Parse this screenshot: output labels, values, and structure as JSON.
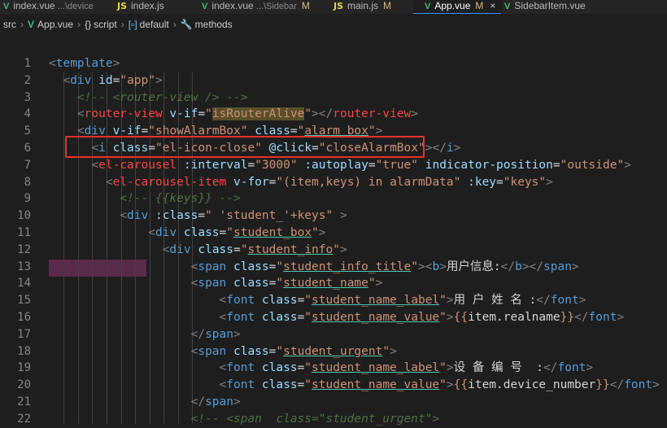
{
  "tabs": [
    {
      "icon": "vue",
      "label": "index.vue",
      "sub": "...\\device",
      "mod": ""
    },
    {
      "icon": "js",
      "label": "index.js",
      "sub": "",
      "mod": ""
    },
    {
      "icon": "vue",
      "label": "index.vue",
      "sub": "...\\Sidebar",
      "mod": "M"
    },
    {
      "icon": "js",
      "label": "main.js",
      "sub": "",
      "mod": "M"
    },
    {
      "icon": "vue",
      "label": "App.vue",
      "sub": "",
      "mod": "M",
      "active": true,
      "close": "×"
    },
    {
      "icon": "vue",
      "label": "SidebarItem.vue",
      "sub": "",
      "mod": ""
    }
  ],
  "breadcrumb": {
    "folder": "src",
    "file": "App.vue",
    "script": "script",
    "default": "default",
    "methods": "methods",
    "script_sym": "{}",
    "default_sym": "[▫]",
    "methods_sym": "🔧"
  },
  "line_numbers": [
    "1",
    "2",
    "3",
    "4",
    "5",
    "6",
    "7",
    "8",
    "9",
    "10",
    "11",
    "12",
    "13",
    "14",
    "15",
    "16",
    "17",
    "18",
    "19",
    "20",
    "21",
    "22"
  ],
  "code_lines": [
    [
      {
        "t": "<",
        "c": "pun"
      },
      {
        "t": "template",
        "c": "tag"
      },
      {
        "t": ">",
        "c": "pun"
      }
    ],
    [
      {
        "t": "  "
      },
      {
        "t": "<",
        "c": "pun"
      },
      {
        "t": "div",
        "c": "tag"
      },
      {
        "t": " id",
        "c": "at"
      },
      {
        "t": "=",
        "c": "txt"
      },
      {
        "t": "\"app\"",
        "c": "str"
      },
      {
        "t": ">",
        "c": "pun"
      }
    ],
    [
      {
        "t": "    "
      },
      {
        "t": "<!-- <router-view /> -->",
        "c": "com"
      }
    ],
    [
      {
        "t": "    "
      },
      {
        "t": "<",
        "c": "pun"
      },
      {
        "t": "router-view",
        "c": "red"
      },
      {
        "t": " v-if",
        "c": "at"
      },
      {
        "t": "=",
        "c": "txt"
      },
      {
        "t": "\"",
        "c": "str"
      },
      {
        "t": "isRouterAlive",
        "c": "str",
        "hl": true
      },
      {
        "t": "\"",
        "c": "str"
      },
      {
        "t": "></",
        "c": "pun"
      },
      {
        "t": "router-view",
        "c": "red"
      },
      {
        "t": ">",
        "c": "pun"
      }
    ],
    [
      {
        "t": "    "
      },
      {
        "t": "<",
        "c": "pun"
      },
      {
        "t": "div",
        "c": "tag"
      },
      {
        "t": " v-if",
        "c": "at"
      },
      {
        "t": "=",
        "c": "txt"
      },
      {
        "t": "\"showAlarmBox\"",
        "c": "str"
      },
      {
        "t": " class",
        "c": "at"
      },
      {
        "t": "=",
        "c": "txt"
      },
      {
        "t": "\"",
        "c": "str"
      },
      {
        "t": "alarm_box",
        "c": "str",
        "u": true
      },
      {
        "t": "\"",
        "c": "str"
      },
      {
        "t": ">",
        "c": "pun"
      }
    ],
    [
      {
        "t": "      "
      },
      {
        "t": "<",
        "c": "pun"
      },
      {
        "t": "i",
        "c": "tag"
      },
      {
        "t": " class",
        "c": "at"
      },
      {
        "t": "=",
        "c": "txt"
      },
      {
        "t": "\"el-icon-close\"",
        "c": "str"
      },
      {
        "t": " @click",
        "c": "at"
      },
      {
        "t": "=",
        "c": "txt"
      },
      {
        "t": "\"closeAlarmBox\"",
        "c": "str"
      },
      {
        "t": "></",
        "c": "pun"
      },
      {
        "t": "i",
        "c": "tag"
      },
      {
        "t": ">",
        "c": "pun"
      }
    ],
    [
      {
        "t": "      "
      },
      {
        "t": "<",
        "c": "pun"
      },
      {
        "t": "el-carousel",
        "c": "red"
      },
      {
        "t": " :interval",
        "c": "at"
      },
      {
        "t": "=",
        "c": "txt"
      },
      {
        "t": "\"3000\"",
        "c": "str"
      },
      {
        "t": " :autoplay",
        "c": "at"
      },
      {
        "t": "=",
        "c": "txt"
      },
      {
        "t": "\"true\"",
        "c": "str"
      },
      {
        "t": " indicator-position",
        "c": "at"
      },
      {
        "t": "=",
        "c": "txt"
      },
      {
        "t": "\"outside\"",
        "c": "str"
      },
      {
        "t": ">",
        "c": "pun"
      }
    ],
    [
      {
        "t": "        "
      },
      {
        "t": "<",
        "c": "pun"
      },
      {
        "t": "el-carousel-item",
        "c": "red"
      },
      {
        "t": " v-for",
        "c": "at"
      },
      {
        "t": "=",
        "c": "txt"
      },
      {
        "t": "\"(item,keys) in alarmData\"",
        "c": "str"
      },
      {
        "t": " :key",
        "c": "at"
      },
      {
        "t": "=",
        "c": "txt"
      },
      {
        "t": "\"keys\"",
        "c": "str"
      },
      {
        "t": ">",
        "c": "pun"
      }
    ],
    [
      {
        "t": "          "
      },
      {
        "t": "<!-- {{keys}} -->",
        "c": "com"
      }
    ],
    [
      {
        "t": "          "
      },
      {
        "t": "<",
        "c": "pun"
      },
      {
        "t": "div",
        "c": "tag"
      },
      {
        "t": " :class",
        "c": "at"
      },
      {
        "t": "=",
        "c": "txt"
      },
      {
        "t": "\" 'student_'+keys\"",
        "c": "str"
      },
      {
        "t": " >",
        "c": "pun"
      }
    ],
    [
      {
        "t": "              "
      },
      {
        "t": "<",
        "c": "pun"
      },
      {
        "t": "div",
        "c": "tag"
      },
      {
        "t": " class",
        "c": "at"
      },
      {
        "t": "=",
        "c": "txt"
      },
      {
        "t": "\"",
        "c": "str"
      },
      {
        "t": "student_box",
        "c": "str",
        "u": true
      },
      {
        "t": "\"",
        "c": "str"
      },
      {
        "t": ">",
        "c": "pun"
      }
    ],
    [
      {
        "t": "                "
      },
      {
        "t": "<",
        "c": "pun"
      },
      {
        "t": "div",
        "c": "tag"
      },
      {
        "t": " class",
        "c": "at"
      },
      {
        "t": "=",
        "c": "txt"
      },
      {
        "t": "\"",
        "c": "str"
      },
      {
        "t": "student_info",
        "c": "str",
        "u": true
      },
      {
        "t": "\"",
        "c": "str"
      },
      {
        "t": ">",
        "c": "pun"
      }
    ],
    [
      {
        "t": "                    "
      },
      {
        "t": "<",
        "c": "pun"
      },
      {
        "t": "span",
        "c": "tag"
      },
      {
        "t": " class",
        "c": "at"
      },
      {
        "t": "=",
        "c": "txt"
      },
      {
        "t": "\"",
        "c": "str"
      },
      {
        "t": "student_info_title",
        "c": "str",
        "u": true
      },
      {
        "t": "\"",
        "c": "str"
      },
      {
        "t": "><",
        "c": "pun"
      },
      {
        "t": "b",
        "c": "tag"
      },
      {
        "t": ">",
        "c": "pun"
      },
      {
        "t": "用户信息:",
        "c": "txt"
      },
      {
        "t": "</",
        "c": "pun"
      },
      {
        "t": "b",
        "c": "tag"
      },
      {
        "t": "></",
        "c": "pun"
      },
      {
        "t": "span",
        "c": "tag"
      },
      {
        "t": ">",
        "c": "pun"
      }
    ],
    [
      {
        "t": "                    "
      },
      {
        "t": "<",
        "c": "pun"
      },
      {
        "t": "span",
        "c": "tag"
      },
      {
        "t": " class",
        "c": "at"
      },
      {
        "t": "=",
        "c": "txt"
      },
      {
        "t": "\"",
        "c": "str"
      },
      {
        "t": "student_name",
        "c": "str",
        "u": true
      },
      {
        "t": "\"",
        "c": "str"
      },
      {
        "t": ">",
        "c": "pun"
      }
    ],
    [
      {
        "t": "                        "
      },
      {
        "t": "<",
        "c": "pun"
      },
      {
        "t": "font",
        "c": "tag"
      },
      {
        "t": " class",
        "c": "at"
      },
      {
        "t": "=",
        "c": "txt"
      },
      {
        "t": "\"",
        "c": "str"
      },
      {
        "t": "student_name_label",
        "c": "str",
        "u": true
      },
      {
        "t": "\"",
        "c": "str"
      },
      {
        "t": ">",
        "c": "pun"
      },
      {
        "t": "用 户 姓 名 :",
        "c": "txt"
      },
      {
        "t": "</",
        "c": "pun"
      },
      {
        "t": "font",
        "c": "tag"
      },
      {
        "t": ">",
        "c": "pun"
      }
    ],
    [
      {
        "t": "                        "
      },
      {
        "t": "<",
        "c": "pun"
      },
      {
        "t": "font",
        "c": "tag"
      },
      {
        "t": " class",
        "c": "at"
      },
      {
        "t": "=",
        "c": "txt"
      },
      {
        "t": "\"",
        "c": "str"
      },
      {
        "t": "student_name_value",
        "c": "str",
        "u": true
      },
      {
        "t": "\"",
        "c": "str"
      },
      {
        "t": ">",
        "c": "pun"
      },
      {
        "t": "{{",
        "c": "str"
      },
      {
        "t": "item.realname",
        "c": "txt"
      },
      {
        "t": "}}",
        "c": "str"
      },
      {
        "t": "</",
        "c": "pun"
      },
      {
        "t": "font",
        "c": "tag"
      },
      {
        "t": ">",
        "c": "pun"
      }
    ],
    [
      {
        "t": "                    "
      },
      {
        "t": "</",
        "c": "pun"
      },
      {
        "t": "span",
        "c": "tag"
      },
      {
        "t": ">",
        "c": "pun"
      }
    ],
    [
      {
        "t": "                    "
      },
      {
        "t": "<",
        "c": "pun"
      },
      {
        "t": "span",
        "c": "tag"
      },
      {
        "t": " class",
        "c": "at"
      },
      {
        "t": "=",
        "c": "txt"
      },
      {
        "t": "\"",
        "c": "str"
      },
      {
        "t": "student_urgent",
        "c": "str",
        "u": true
      },
      {
        "t": "\"",
        "c": "str"
      },
      {
        "t": ">",
        "c": "pun"
      }
    ],
    [
      {
        "t": "                        "
      },
      {
        "t": "<",
        "c": "pun"
      },
      {
        "t": "font",
        "c": "tag"
      },
      {
        "t": " class",
        "c": "at"
      },
      {
        "t": "=",
        "c": "txt"
      },
      {
        "t": "\"",
        "c": "str"
      },
      {
        "t": "student_name_label",
        "c": "str",
        "u": true
      },
      {
        "t": "\"",
        "c": "str"
      },
      {
        "t": ">",
        "c": "pun"
      },
      {
        "t": "设 备 编 号  :",
        "c": "txt"
      },
      {
        "t": "</",
        "c": "pun"
      },
      {
        "t": "font",
        "c": "tag"
      },
      {
        "t": ">",
        "c": "pun"
      }
    ],
    [
      {
        "t": "                        "
      },
      {
        "t": "<",
        "c": "pun"
      },
      {
        "t": "font",
        "c": "tag"
      },
      {
        "t": " class",
        "c": "at"
      },
      {
        "t": "=",
        "c": "txt"
      },
      {
        "t": "\"",
        "c": "str"
      },
      {
        "t": "student_name_value",
        "c": "str",
        "u": true
      },
      {
        "t": "\"",
        "c": "str"
      },
      {
        "t": ">",
        "c": "pun"
      },
      {
        "t": "{{",
        "c": "str"
      },
      {
        "t": "item.device_number",
        "c": "txt"
      },
      {
        "t": "}}",
        "c": "str"
      },
      {
        "t": "</",
        "c": "pun"
      },
      {
        "t": "font",
        "c": "tag"
      },
      {
        "t": ">",
        "c": "pun"
      }
    ],
    [
      {
        "t": "                    "
      },
      {
        "t": "</",
        "c": "pun"
      },
      {
        "t": "span",
        "c": "tag"
      },
      {
        "t": ">",
        "c": "pun"
      }
    ],
    [
      {
        "t": "                    "
      },
      {
        "t": "<!-- <span  class=\"student_urgent\">",
        "c": "com"
      }
    ]
  ]
}
